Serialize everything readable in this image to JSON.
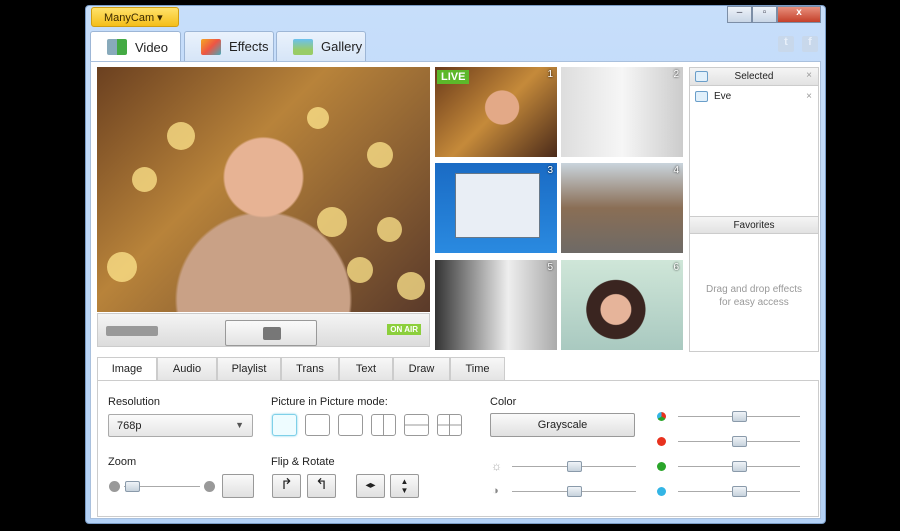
{
  "app": {
    "brand_menu": "ManyCam ▾",
    "window_buttons": [
      "minimize",
      "maximize",
      "close"
    ]
  },
  "top_tabs": [
    {
      "label": "Video",
      "icon": "video-icon",
      "active": true
    },
    {
      "label": "Effects",
      "icon": "effects-icon"
    },
    {
      "label": "Gallery",
      "icon": "gallery-icon"
    }
  ],
  "social": [
    "t",
    "f"
  ],
  "preview": {
    "on_air": "ON AIR"
  },
  "thumbnails": [
    {
      "num": "1",
      "live": "LIVE"
    },
    {
      "num": "2"
    },
    {
      "num": "3"
    },
    {
      "num": "4"
    },
    {
      "num": "5"
    },
    {
      "num": "6"
    }
  ],
  "side": {
    "selected_title": "Selected",
    "selected_items": [
      "Eve"
    ],
    "favorites_title": "Favorites",
    "favorites_hint": "Drag and drop effects for easy access"
  },
  "bottom_tabs": [
    "Image",
    "Audio",
    "Playlist",
    "Trans",
    "Text",
    "Draw",
    "Time"
  ],
  "image_panel": {
    "resolution_label": "Resolution",
    "resolution_value": "768p",
    "pip_label": "Picture in Picture mode:",
    "zoom_label": "Zoom",
    "zoom_value": 0.1,
    "flip_label": "Flip & Rotate",
    "color_label": "Color",
    "grayscale_button": "Grayscale",
    "brightness": 0.5,
    "contrast": 0.5,
    "color_sliders": [
      {
        "name": "saturation",
        "color": "#888888",
        "value": 0.5
      },
      {
        "name": "red",
        "color": "#e8321e",
        "value": 0.5
      },
      {
        "name": "green",
        "color": "#2aa52a",
        "value": 0.5
      },
      {
        "name": "blue",
        "color": "#33b5e5",
        "value": 0.5
      }
    ]
  }
}
